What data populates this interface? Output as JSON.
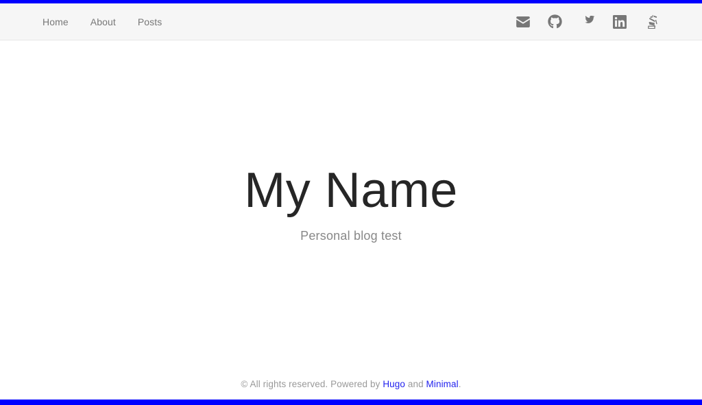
{
  "theme": {
    "accent_color": "#0000ff",
    "navbar_bg": "#f6f6f6",
    "nav_link_color": "#777777",
    "title_color": "#262626",
    "subtitle_color": "#888888",
    "footer_text_color": "#999999",
    "footer_link_color": "#2222ee",
    "page_bg": "#ffffff"
  },
  "navbar": {
    "links": [
      {
        "label": "Home",
        "name": "nav-link-home"
      },
      {
        "label": "About",
        "name": "nav-link-about"
      },
      {
        "label": "Posts",
        "name": "nav-link-posts"
      }
    ],
    "social": [
      {
        "icon": "envelope-icon",
        "label": "Email"
      },
      {
        "icon": "github-icon",
        "label": "GitHub"
      },
      {
        "icon": "twitter-icon",
        "label": "Twitter"
      },
      {
        "icon": "linkedin-icon",
        "label": "LinkedIn"
      },
      {
        "icon": "stackoverflow-icon",
        "label": "Stack Overflow"
      }
    ]
  },
  "hero": {
    "title": "My Name",
    "subtitle": "Personal blog test"
  },
  "footer": {
    "copyright": "© All rights reserved. Powered by ",
    "generator_link": "Hugo",
    "conjunction": " and ",
    "theme_link": "Minimal",
    "period": "."
  }
}
